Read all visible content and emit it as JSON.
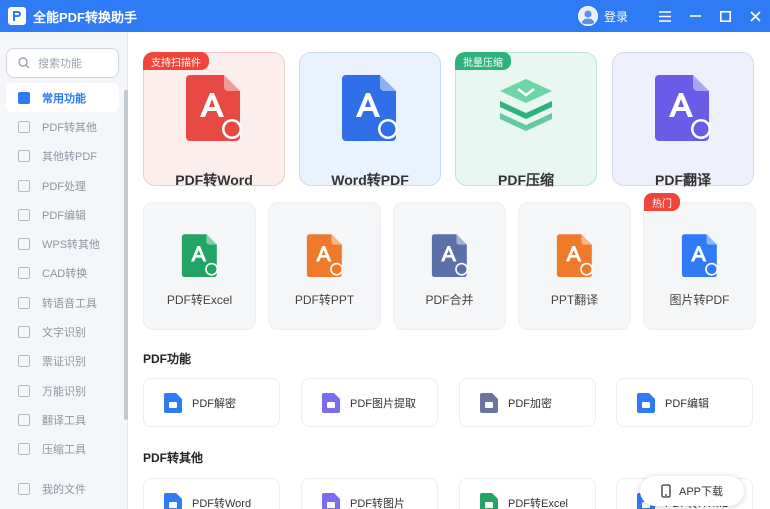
{
  "app": {
    "title": "全能PDF转换助手",
    "login_label": "登录"
  },
  "search": {
    "placeholder": "搜索功能"
  },
  "sidebar": {
    "items": [
      {
        "label": "常用功能",
        "active": true
      },
      {
        "label": "PDF转其他"
      },
      {
        "label": "其他转PDF"
      },
      {
        "label": "PDF处理"
      },
      {
        "label": "PDF编辑"
      },
      {
        "label": "WPS转其他"
      },
      {
        "label": "CAD转换"
      },
      {
        "label": "转语音工具"
      },
      {
        "label": "文字识别"
      },
      {
        "label": "票证识别"
      },
      {
        "label": "万能识别"
      },
      {
        "label": "翻译工具"
      },
      {
        "label": "压缩工具"
      }
    ],
    "my_files": "我的文件"
  },
  "featured": [
    {
      "label": "PDF转Word",
      "badge": "支持扫描件",
      "icon": "pdf-to-word-icon",
      "bg": "#fdeeee",
      "border": "#f6c9c9",
      "badge_color": "#f0453a",
      "color": "#e84a43"
    },
    {
      "label": "Word转PDF",
      "badge": "",
      "icon": "word-to-pdf-icon",
      "bg": "#eaf2fd",
      "border": "#c9dcf6",
      "color": "#2f6fe8"
    },
    {
      "label": "PDF压缩",
      "badge": "批量压缩",
      "icon": "pdf-compress-icon",
      "bg": "#e8f7f1",
      "border": "#bde8d6",
      "badge_color": "#2fb37e",
      "color": "#2fb37e"
    },
    {
      "label": "PDF翻译",
      "badge": "",
      "icon": "pdf-translate-icon",
      "bg": "#eef0fb",
      "border": "#d4d9f2",
      "color": "#6a5ce6"
    }
  ],
  "tools": [
    {
      "label": "PDF转Excel",
      "icon": "pdf-to-excel-icon",
      "color": "#21a466"
    },
    {
      "label": "PDF转PPT",
      "icon": "pdf-to-ppt-icon",
      "color": "#f07a2a"
    },
    {
      "label": "PDF合并",
      "icon": "pdf-merge-icon",
      "color": "#5b6fa8"
    },
    {
      "label": "PPT翻译",
      "icon": "ppt-translate-icon",
      "color": "#f07a2a"
    },
    {
      "label": "图片转PDF",
      "icon": "image-to-pdf-icon",
      "color": "#2f7bf5",
      "badge": "热门"
    }
  ],
  "pdf_functions": {
    "title": "PDF功能",
    "items": [
      {
        "label": "PDF解密",
        "icon": "unlock-icon",
        "color": "#2f7bf5"
      },
      {
        "label": "PDF图片提取",
        "icon": "image-extract-icon",
        "color": "#7b6df2"
      },
      {
        "label": "PDF加密",
        "icon": "lock-icon",
        "color": "#6c74a0"
      },
      {
        "label": "PDF编辑",
        "icon": "edit-icon",
        "color": "#2f7bf5"
      }
    ]
  },
  "pdf_convert_other": {
    "title": "PDF转其他",
    "items": [
      {
        "label": "PDF转Word",
        "icon": "pdf-to-word-icon",
        "color": "#2f7bf5"
      },
      {
        "label": "PDF转图片",
        "icon": "pdf-to-image-icon",
        "color": "#7b6df2"
      },
      {
        "label": "PDF转Excel",
        "icon": "pdf-to-excel-icon",
        "color": "#21a466"
      },
      {
        "label": "PDF转HTML",
        "icon": "pdf-to-html-icon",
        "color": "#2f7bf5"
      }
    ]
  },
  "app_download": {
    "label": "APP下载"
  }
}
